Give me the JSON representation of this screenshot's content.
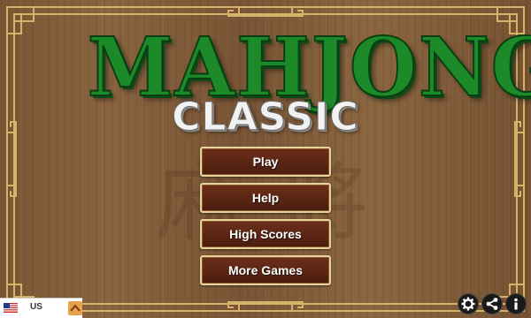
{
  "title": {
    "main": "MAHJONG",
    "sub": "CLASSIC"
  },
  "menu": {
    "items": [
      {
        "label": "Play"
      },
      {
        "label": "Help"
      },
      {
        "label": "High Scores"
      },
      {
        "label": "More Games"
      }
    ]
  },
  "language": {
    "code": "US"
  },
  "colors": {
    "title_green": "#1d8a2a",
    "button_brown": "#5b2514",
    "button_border": "#e8d49a",
    "frame_gold": "#d7b36a"
  },
  "icons": [
    "us-flag-icon",
    "chevron-up-icon",
    "gear-icon",
    "share-icon",
    "info-icon"
  ]
}
